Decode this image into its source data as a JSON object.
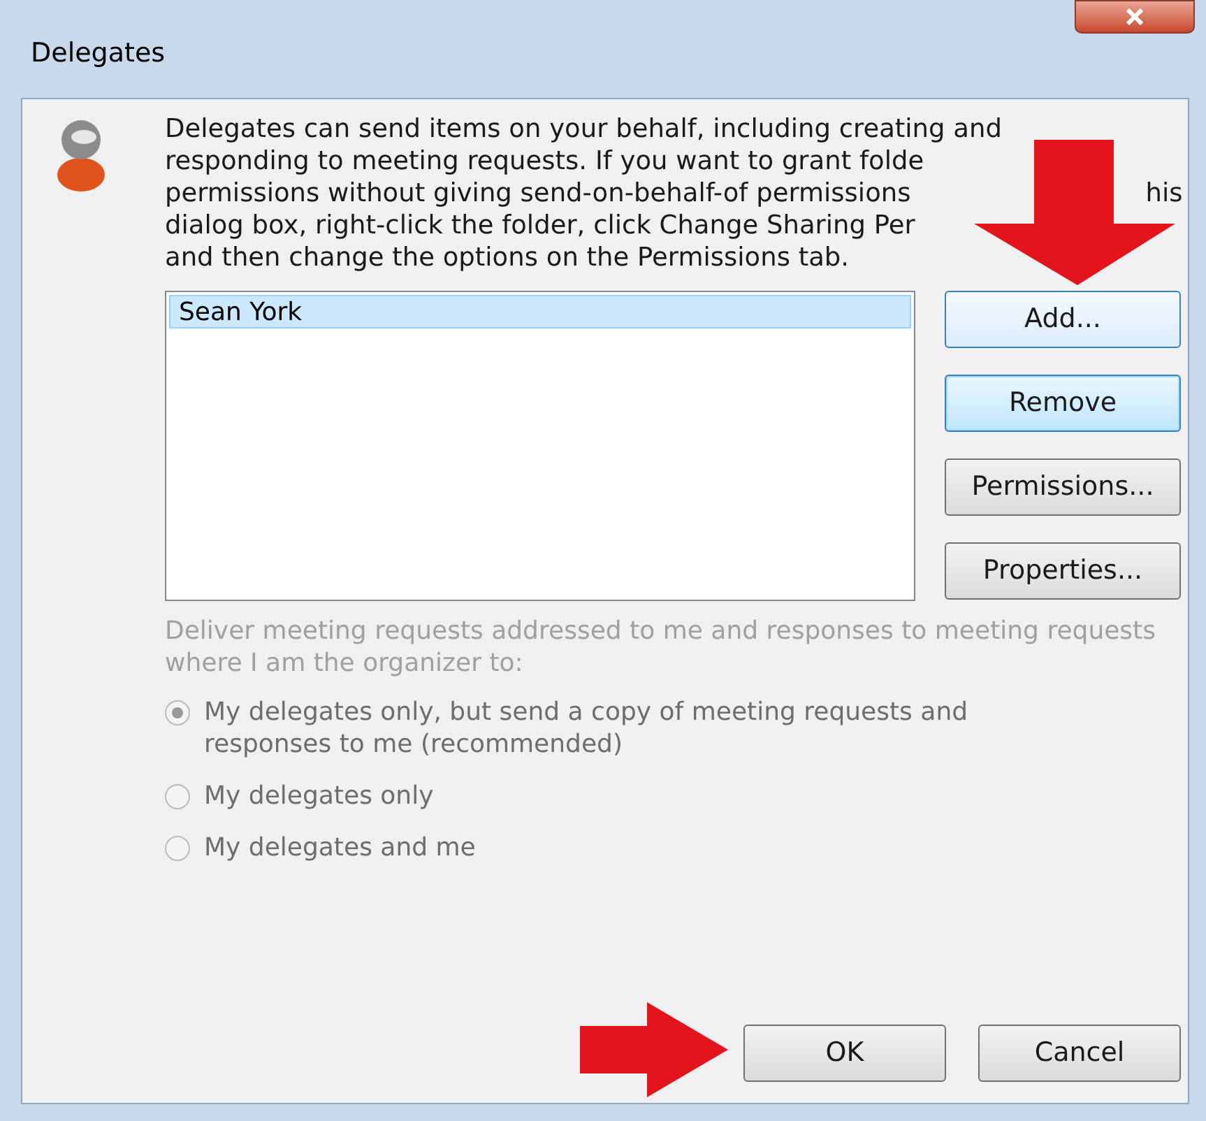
{
  "window": {
    "title": "Delegates"
  },
  "description": {
    "lines": [
      [
        "Delegates can send items on your behalf, including creating and"
      ],
      [
        "responding to meeting requests. If you want to grant folde"
      ],
      [
        "permissions without giving send-on-behalf-of permissions",
        "his"
      ],
      [
        "dialog box, right-click the folder, click Change Sharing Per"
      ],
      [
        "and then change the options on the Permissions tab."
      ]
    ]
  },
  "delegates_list": [
    {
      "name": "Sean York",
      "selected": true
    }
  ],
  "side_buttons": [
    {
      "label": "Add...",
      "hover": true,
      "focused": false
    },
    {
      "label": "Remove",
      "hover": false,
      "focused": true
    },
    {
      "label": "Permissions...",
      "hover": false,
      "focused": false
    },
    {
      "label": "Properties...",
      "hover": false,
      "focused": false
    }
  ],
  "deliver_group": {
    "label": "Deliver meeting requests addressed to me and responses to meeting requests where I am the organizer to:",
    "disabled": true,
    "options": [
      {
        "label": "My delegates only, but send a copy of meeting requests and responses to me (recommended)",
        "selected": true
      },
      {
        "label": "My delegates only",
        "selected": false
      },
      {
        "label": "My delegates and me",
        "selected": false
      }
    ]
  },
  "buttons": [
    "OK",
    "Cancel"
  ]
}
